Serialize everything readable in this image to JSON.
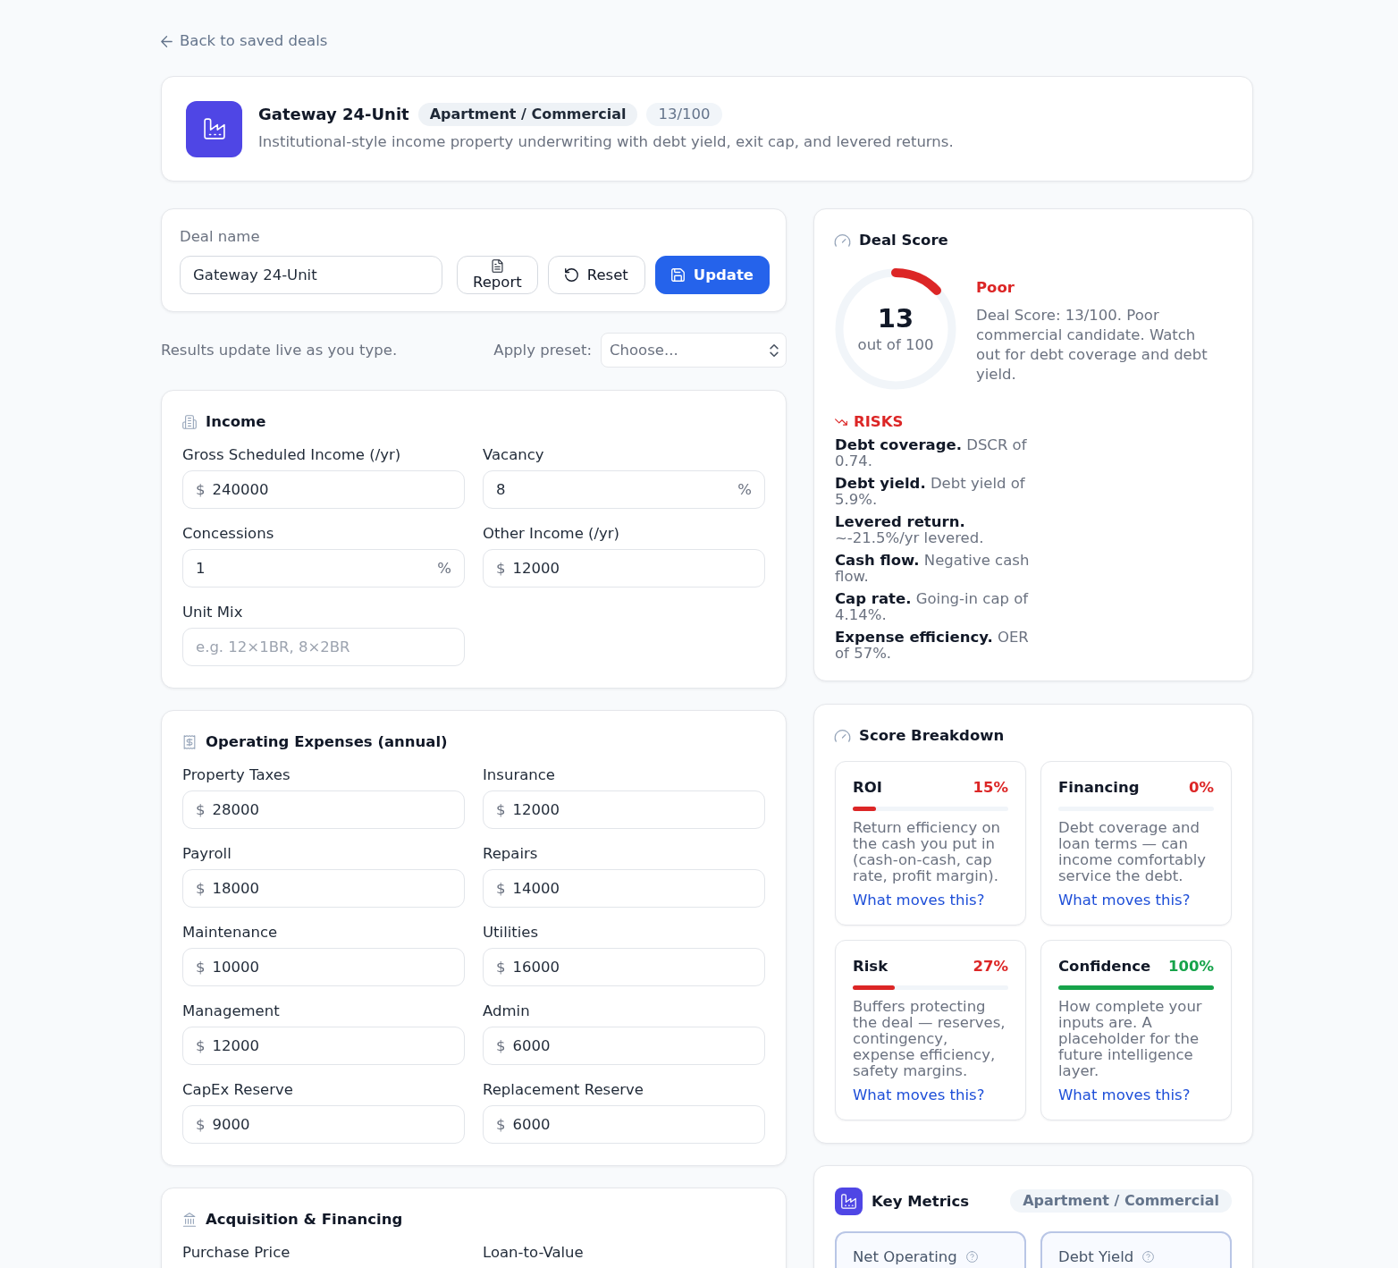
{
  "back_link": {
    "label": "Back to saved deals"
  },
  "header": {
    "title": "Gateway 24-Unit",
    "badges": [
      {
        "label": "Apartment / Commercial",
        "kind": "category"
      },
      {
        "label": "13/100",
        "kind": "score"
      }
    ],
    "description": "Institutional-style income property underwriting with debt yield, exit cap, and levered returns."
  },
  "deal_form": {
    "label": "Deal name",
    "value": "Gateway 24-Unit",
    "buttons": [
      {
        "label": "Report",
        "kind": "report"
      },
      {
        "label": "Reset",
        "kind": "reset"
      },
      {
        "label": "Update",
        "kind": "update"
      }
    ]
  },
  "live_hint": "Results update live as you type.",
  "preset": {
    "label": "Apply preset:",
    "placeholder": "Choose..."
  },
  "sections": [
    {
      "title": "Income",
      "kind": "income",
      "fields": [
        {
          "label": "Gross Scheduled Income (/yr)",
          "prefix": "$",
          "value": "240000"
        },
        {
          "label": "Vacancy",
          "value": "8",
          "suffix": "%"
        },
        {
          "label": "Concessions",
          "value": "1",
          "suffix": "%"
        },
        {
          "label": "Other Income (/yr)",
          "prefix": "$",
          "value": "12000"
        },
        {
          "label": "Unit Mix",
          "placeholder": "e.g. 12×1BR, 8×2BR"
        }
      ]
    },
    {
      "title": "Operating Expenses (annual)",
      "kind": "expenses",
      "fields": [
        {
          "label": "Property Taxes",
          "prefix": "$",
          "value": "28000"
        },
        {
          "label": "Insurance",
          "prefix": "$",
          "value": "12000"
        },
        {
          "label": "Payroll",
          "prefix": "$",
          "value": "18000"
        },
        {
          "label": "Repairs",
          "prefix": "$",
          "value": "14000"
        },
        {
          "label": "Maintenance",
          "prefix": "$",
          "value": "10000"
        },
        {
          "label": "Utilities",
          "prefix": "$",
          "value": "16000"
        },
        {
          "label": "Management",
          "prefix": "$",
          "value": "12000"
        },
        {
          "label": "Admin",
          "prefix": "$",
          "value": "6000"
        },
        {
          "label": "CapEx Reserve",
          "prefix": "$",
          "value": "9000"
        },
        {
          "label": "Replacement Reserve",
          "prefix": "$",
          "value": "6000"
        }
      ]
    },
    {
      "title": "Acquisition & Financing",
      "kind": "financing",
      "fields": [
        {
          "label": "Purchase Price"
        },
        {
          "label": "Loan-to-Value"
        }
      ]
    }
  ],
  "deal_score": {
    "title": "Deal Score",
    "score": "13",
    "caption": "out of 100",
    "level": 0.13,
    "rating": "Poor",
    "summary": "Deal Score: 13/100. Poor commercial candidate. Watch out for debt coverage and debt yield.",
    "risks_title": "RISKS",
    "risks": [
      "**Debt coverage.** DSCR of 0.74.",
      "**Debt yield.** Debt yield of 5.9%.",
      "**Levered return.** ~-21.5%/yr levered.",
      "**Cash flow.** Negative cash flow.",
      "**Cap rate.** Going-in cap of 4.14%.",
      "**Expense efficiency.** OER of 57%."
    ]
  },
  "score_breakdown": {
    "title": "Score Breakdown",
    "items": [
      {
        "name": "ROI",
        "percent": "15%",
        "level": 0.15,
        "color": "#dc2626",
        "description": "Return efficiency on the cash you put in (cash-on-cash, cap rate, profit margin).",
        "link": "What moves this?"
      },
      {
        "name": "Financing",
        "percent": "0%",
        "color": "#dc2626",
        "description": "Debt coverage and loan terms — can income comfortably service the debt.",
        "link": "What moves this?"
      },
      {
        "name": "Risk",
        "percent": "27%",
        "level": 0.27,
        "color": "#dc2626",
        "description": "Buffers protecting the deal — reserves, contingency, expense efficiency, safety margins.",
        "link": "What moves this?"
      },
      {
        "name": "Confidence",
        "percent": "100%",
        "level": 1,
        "color": "#16a34a",
        "description": "How complete your inputs are. A placeholder for the future intelligence layer.",
        "link": "What moves this?"
      }
    ]
  },
  "key_metrics": {
    "title": "Key Metrics",
    "badge": "Apartment / Commercial",
    "metrics": [
      {
        "label": "Net Operating"
      },
      {
        "label": "Debt Yield"
      }
    ]
  }
}
